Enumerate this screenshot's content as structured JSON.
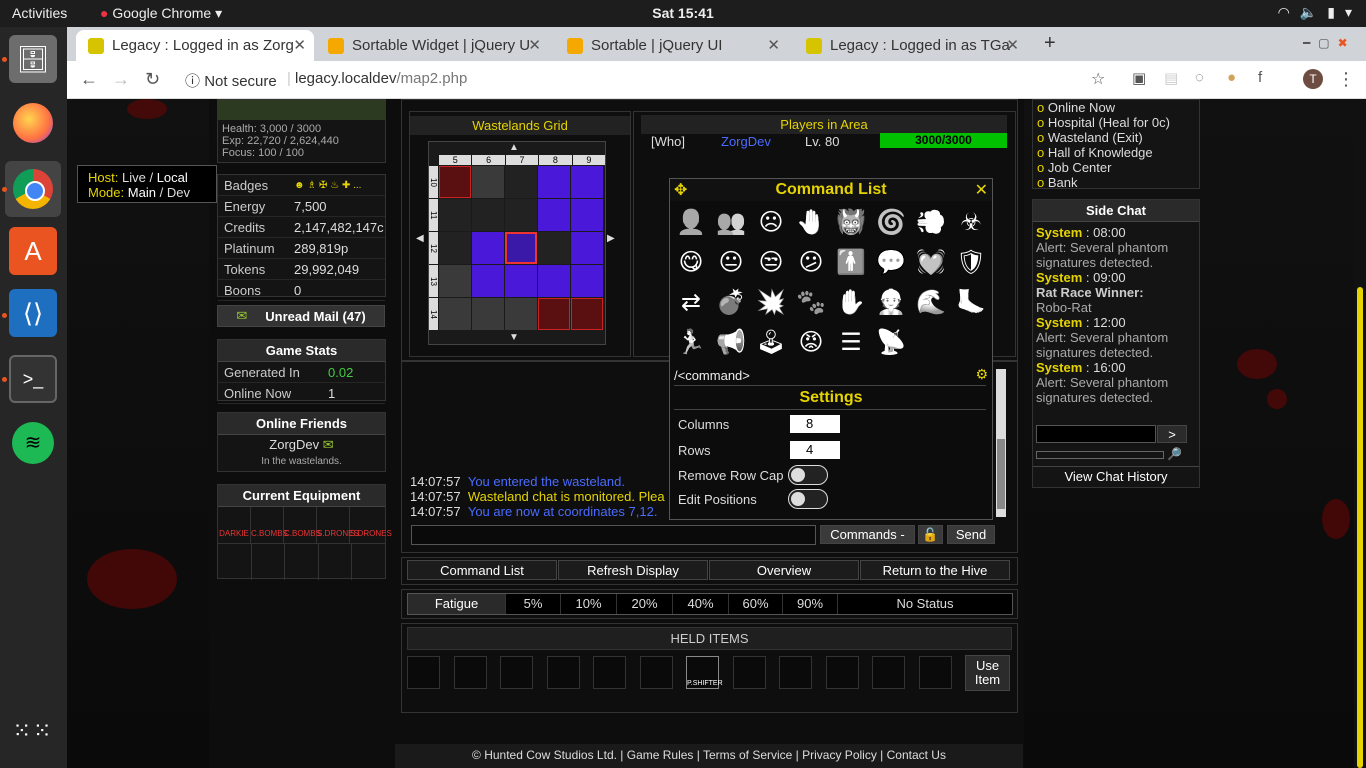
{
  "os": {
    "activities": "Activities",
    "app_name": "Google Chrome",
    "clock": "Sat 15:41"
  },
  "browser": {
    "tabs": [
      {
        "title": "Legacy : Logged in as Zorg",
        "color": "#d7c400"
      },
      {
        "title": "Sortable Widget | jQuery U",
        "color": "#f5a800"
      },
      {
        "title": "Sortable | jQuery UI",
        "color": "#f5a800"
      },
      {
        "title": "Legacy : Logged in as TGa",
        "color": "#d7c400"
      }
    ],
    "new_tab": "+",
    "security": "Not secure",
    "url_host": "legacy.localdev",
    "url_path": "/map2.php"
  },
  "left": {
    "health_label": "Health:",
    "health_value": "3,000 / 3000",
    "exp_label": "Exp:",
    "exp_value": "22,720 / 2,624,440",
    "focus_label": "Focus:",
    "focus_value": "100 / 100",
    "host_label": "Host:",
    "host_live": "Live",
    "host_sep": "/",
    "host_local": "Local",
    "mode_label": "Mode:",
    "mode_main": "Main",
    "mode_sep": "/",
    "mode_dev": "Dev",
    "stats": [
      {
        "k": "Badges",
        "v": "☻ ♗ ✠ ♨ ✚ ..."
      },
      {
        "k": "Energy",
        "v": "7,500"
      },
      {
        "k": "Credits",
        "v": "2,147,482,147c"
      },
      {
        "k": "Platinum",
        "v": "289,819p"
      },
      {
        "k": "Tokens",
        "v": "29,992,049"
      },
      {
        "k": "Boons",
        "v": "0"
      }
    ],
    "mail": "Unread Mail (47)",
    "game_stats_title": "Game Stats",
    "game_stats": [
      {
        "k": "Generated In",
        "v": "0.02"
      },
      {
        "k": "Online Now",
        "v": "1"
      }
    ],
    "friends_title": "Online Friends",
    "friend_name": "ZorgDev",
    "friend_status": "In the wastelands.",
    "equipment_title": "Current Equipment",
    "equipment": [
      "DARKIE",
      "C.BOMBS",
      "C.BOMBS",
      "S.DRONES",
      "S.DRONES"
    ]
  },
  "grid": {
    "title": "Wastelands Grid",
    "cols": [
      "5",
      "6",
      "7",
      "8",
      "9"
    ],
    "rows": [
      "10",
      "11",
      "12",
      "13",
      "14"
    ]
  },
  "players": {
    "title": "Players in Area",
    "who": "[Who]",
    "name": "ZorgDev",
    "level": "Lv. 80",
    "hp": "3000/3000"
  },
  "command_list": {
    "title": "Command List",
    "command": "/<command>",
    "settings_title": "Settings",
    "columns_label": "Columns",
    "columns_value": "8",
    "rows_label": "Rows",
    "rows_value": "4",
    "row_cap_label": "Remove Row Cap",
    "edit_positions_label": "Edit Positions",
    "icons": [
      "👤",
      "👥",
      "☹",
      "🤚",
      "👹",
      "🌀",
      "💨",
      "☣",
      "😋",
      "😐",
      "😒",
      "😕",
      "🚹",
      "💬",
      "💓",
      "🛡",
      "⇄",
      "💣",
      "💥",
      "🐾",
      "✋",
      "👷",
      "🌊",
      "🦶",
      "🏃",
      "📢",
      "🕹",
      "😡",
      "☰",
      "📡"
    ]
  },
  "chat": {
    "lines": [
      {
        "time": "14:07:57",
        "text": "You entered the wasteland.",
        "color": "#4a6bff"
      },
      {
        "time": "14:07:57",
        "text": "Wasteland chat is monitored. Plea",
        "color": "#e6d400"
      },
      {
        "time": "14:07:57",
        "text": "You are now at coordinates 7,12.",
        "color": "#4a6bff"
      }
    ],
    "commands_btn": "Commands -",
    "send_btn": "Send"
  },
  "actions": [
    "Command List",
    "Refresh Display",
    "Overview",
    "Return to the Hive"
  ],
  "fatigue": {
    "label": "Fatigue",
    "levels": [
      "5%",
      "10%",
      "20%",
      "40%",
      "60%",
      "90%"
    ],
    "status": "No Status"
  },
  "held": {
    "title": "HELD ITEMS",
    "item": "P.SHIFTER",
    "use_btn_1": "Use",
    "use_btn_2": "Item"
  },
  "right": {
    "locations": [
      "Online Now",
      "Hospital (Heal for 0c)",
      "Wasteland (Exit)",
      "Hall of Knowledge",
      "Job Center",
      "Bank"
    ],
    "side_chat_title": "Side Chat",
    "side_chat": [
      {
        "who": "System",
        "time": " : 08:00",
        "text": "Alert: Several phantom signatures detected."
      },
      {
        "who": "System",
        "time": " : 09:00",
        "text": "Rat Race Winner:",
        "bold": "Robo-Rat"
      },
      {
        "who": "System",
        "time": " : 12:00",
        "text": "Alert: Several phantom signatures detected."
      },
      {
        "who": "System",
        "time": " : 16:00",
        "text": "Alert: Several phantom signatures detected."
      }
    ],
    "send_btn": ">",
    "history": "View Chat History"
  },
  "footer": "© Hunted Cow Studios Ltd. | Game Rules | Terms of Service | Privacy Policy | Contact Us"
}
